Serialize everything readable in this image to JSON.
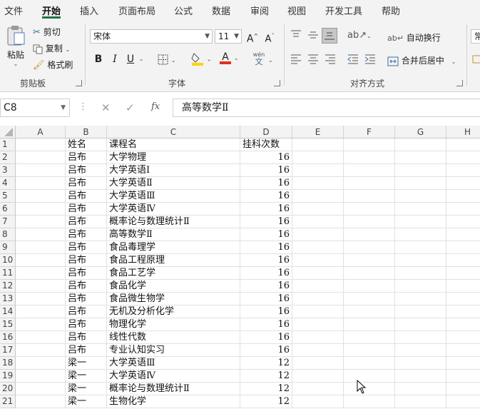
{
  "ribbon_tabs": [
    "文件",
    "开始",
    "插入",
    "页面布局",
    "公式",
    "数据",
    "审阅",
    "视图",
    "开发工具",
    "帮助"
  ],
  "active_tab": "开始",
  "clipboard": {
    "paste": "粘贴",
    "cut": "剪切",
    "copy": "复制",
    "format_painter": "格式刷",
    "label": "剪贴板"
  },
  "font": {
    "name": "宋体",
    "size": "11",
    "grow": "A^",
    "shrink": "Aˇ",
    "bold": "B",
    "italic": "I",
    "underline": "U",
    "font_color_letter": "A",
    "phonetic": "wén",
    "phonetic_char": "文",
    "label": "字体",
    "fill_color": "#ffd400",
    "font_color": "#e0301e"
  },
  "alignment": {
    "wrap_text": "自动换行",
    "merge_center": "合并后居中",
    "label": "对齐方式"
  },
  "number": {
    "format": "常"
  },
  "name_box": "C8",
  "formula_bar": {
    "cancel": "✕",
    "enter": "✓",
    "fx": "fx",
    "content": "高等数学Ⅱ"
  },
  "columns": [
    "A",
    "B",
    "C",
    "D",
    "E",
    "F",
    "G",
    "H"
  ],
  "row_numbers": [
    "1",
    "2",
    "3",
    "4",
    "5",
    "6",
    "7",
    "8",
    "9",
    "10",
    "11",
    "12",
    "13",
    "14",
    "15",
    "16",
    "17",
    "18",
    "19",
    "20",
    "21"
  ],
  "rows": [
    [
      "",
      "姓名",
      "课程名",
      "挂科次数"
    ],
    [
      "",
      "吕布",
      "大学物理",
      "16"
    ],
    [
      "",
      "吕布",
      "大学英语Ⅰ",
      "16"
    ],
    [
      "",
      "吕布",
      "大学英语Ⅱ",
      "16"
    ],
    [
      "",
      "吕布",
      "大学英语Ⅲ",
      "16"
    ],
    [
      "",
      "吕布",
      "大学英语Ⅳ",
      "16"
    ],
    [
      "",
      "吕布",
      "概率论与数理统计Ⅱ",
      "16"
    ],
    [
      "",
      "吕布",
      "高等数学Ⅱ",
      "16"
    ],
    [
      "",
      "吕布",
      "食品毒理学",
      "16"
    ],
    [
      "",
      "吕布",
      "食品工程原理",
      "16"
    ],
    [
      "",
      "吕布",
      "食品工艺学",
      "16"
    ],
    [
      "",
      "吕布",
      "食品化学",
      "16"
    ],
    [
      "",
      "吕布",
      "食品微生物学",
      "16"
    ],
    [
      "",
      "吕布",
      "无机及分析化学",
      "16"
    ],
    [
      "",
      "吕布",
      "物理化学",
      "16"
    ],
    [
      "",
      "吕布",
      "线性代数",
      "16"
    ],
    [
      "",
      "吕布",
      "专业认知实习",
      "16"
    ],
    [
      "",
      "梁一",
      "大学英语Ⅲ",
      "12"
    ],
    [
      "",
      "梁一",
      "大学英语Ⅳ",
      "12"
    ],
    [
      "",
      "梁一",
      "概率论与数理统计Ⅱ",
      "12"
    ],
    [
      "",
      "梁一",
      "生物化学",
      "12"
    ]
  ],
  "accent": "#217346"
}
